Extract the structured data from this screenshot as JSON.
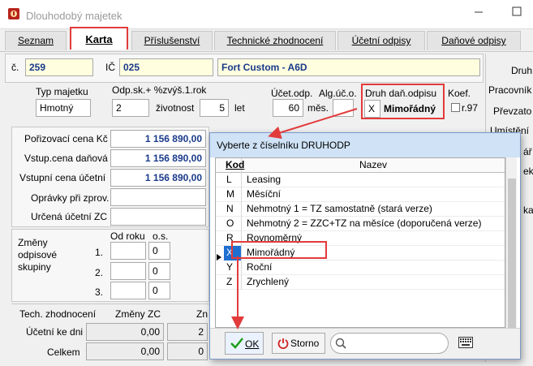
{
  "window": {
    "title": "Dlouhodobý majetek"
  },
  "tabs": [
    "Seznam",
    "Karta",
    "Příslušenství",
    "Technické zhodnocení",
    "Účetní odpisy",
    "Daňové odpisy"
  ],
  "header": {
    "c_label": "č.",
    "c_value": "259",
    "ic_label": "IČ",
    "ic_value": "025",
    "name_value": "Fort Custom - A6D"
  },
  "right_labels": [
    "Druh",
    "Pracovník",
    "Převzato",
    "Umístění",
    "ář",
    "ek",
    "ka"
  ],
  "typ": {
    "typ_label": "Typ majetku",
    "typ_value": "Hmotný",
    "odp_label": "Odp.sk.+ %zvýš.1.rok",
    "odp_value": "2",
    "zivotnost_label": "životnost",
    "zivotnost_value": "5",
    "let_label": "let",
    "ucet_label": "Účet.odp.",
    "ucet_value": "60",
    "mes_label": "měs.",
    "alg_label": "Alg.úč.o.",
    "druh_label": "Druh daň.odpisu",
    "druh_code": "X",
    "druh_name": "Mimořádný",
    "koef_label": "Koef.",
    "r97_label": "r.97"
  },
  "values": {
    "porizovaci_label": "Pořizovací cena Kč",
    "porizovaci_value": "1 156 890,00",
    "vstup_dan_label": "Vstup.cena daňová",
    "vstup_dan_value": "1 156 890,00",
    "vstup_uc_label": "Vstupní cena účetní",
    "vstup_uc_value": "1 156 890,00",
    "opravky_label": "Oprávky při zprov.",
    "urcena_label": "Určená účetní ZC"
  },
  "zmeny": {
    "label_lines": [
      "Změny",
      "odpisové",
      "skupiny"
    ],
    "od_roku_label": "Od roku",
    "os_label": "o.s.",
    "rows": [
      {
        "n": "1.",
        "os": "0"
      },
      {
        "n": "2.",
        "os": "0"
      },
      {
        "n": "3.",
        "os": "0"
      }
    ],
    "side_label": "Rovnoměrn"
  },
  "tech": {
    "tech_label": "Tech. zhodnocení",
    "zmeny_zc_label": "Změny ZC",
    "zn_label": "Zn",
    "ucetni_label": "Účetní ke dni",
    "ucetni_value": "0,00",
    "ucetni_side": "2",
    "celkem_label": "Celkem",
    "celkem_value": "0,00",
    "celkem_side": "0"
  },
  "dialog": {
    "title": "Vyberte z číselníku DRUHODP",
    "col_code": "Kod",
    "col_name": "Nazev",
    "rows": [
      {
        "code": "L",
        "name": "Leasing"
      },
      {
        "code": "M",
        "name": "Měsíční"
      },
      {
        "code": "N",
        "name": "Nehmotný 1 = TZ samostatně (stará verze)"
      },
      {
        "code": "O",
        "name": "Nehmotný 2 = ZZC+TZ na měsíce (doporučená verze)"
      },
      {
        "code": "R",
        "name": "Rovnoměrný"
      },
      {
        "code": "X",
        "name": "Mimořádný"
      },
      {
        "code": "Y",
        "name": "Roční"
      },
      {
        "code": "Z",
        "name": "Zrychlený"
      }
    ],
    "selected_index": 5,
    "ok_label": "OK",
    "storno_label": "Storno",
    "search_value": ""
  },
  "colors": {
    "accent_red": "#e23b3b",
    "selection_blue": "#1f6fd1",
    "value_blue": "#1a3a8a",
    "field_yellow": "#ffffe0"
  }
}
